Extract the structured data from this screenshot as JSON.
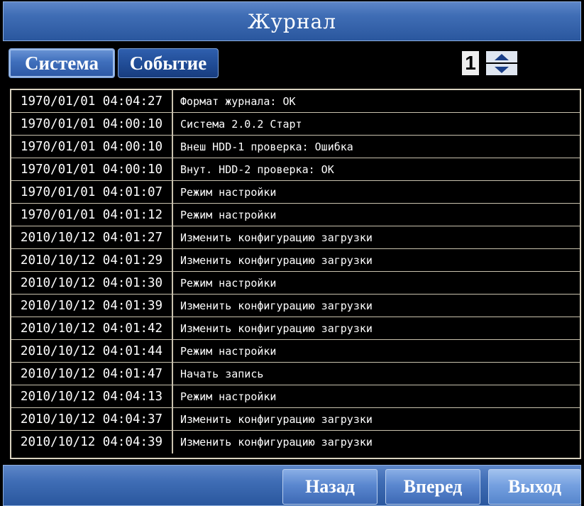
{
  "header": {
    "title": "Журнал"
  },
  "tabs": [
    {
      "label": "Система",
      "active": true
    },
    {
      "label": "Событие",
      "active": false
    }
  ],
  "pager": {
    "page": "1"
  },
  "log": {
    "rows": [
      {
        "time": "1970/01/01 04:04:27",
        "message": "Формат журнала: OK"
      },
      {
        "time": "1970/01/01 04:00:10",
        "message": "Система 2.0.2 Старт"
      },
      {
        "time": "1970/01/01 04:00:10",
        "message": "Внеш HDD-1 проверка: Ошибка"
      },
      {
        "time": "1970/01/01 04:00:10",
        "message": "Внут.  HDD-2 проверка: OK"
      },
      {
        "time": "1970/01/01 04:01:07",
        "message": "Режим настройки"
      },
      {
        "time": "1970/01/01 04:01:12",
        "message": "Режим настройки"
      },
      {
        "time": "2010/10/12 04:01:27",
        "message": "Изменить конфигурацию загрузки"
      },
      {
        "time": "2010/10/12 04:01:29",
        "message": "Изменить конфигурацию загрузки"
      },
      {
        "time": "2010/10/12 04:01:30",
        "message": "Режим настройки"
      },
      {
        "time": "2010/10/12 04:01:39",
        "message": "Изменить конфигурацию загрузки"
      },
      {
        "time": "2010/10/12 04:01:42",
        "message": "Изменить конфигурацию загрузки"
      },
      {
        "time": "2010/10/12 04:01:44",
        "message": "Режим настройки"
      },
      {
        "time": "2010/10/12 04:01:47",
        "message": "Начать запись"
      },
      {
        "time": "2010/10/12 04:04:13",
        "message": "Режим настройки"
      },
      {
        "time": "2010/10/12 04:04:37",
        "message": "Изменить конфигурацию загрузки"
      },
      {
        "time": "2010/10/12 04:04:39",
        "message": "Изменить конфигурацию загрузки"
      }
    ]
  },
  "footer": {
    "back_label": "Назад",
    "next_label": "Вперед",
    "exit_label": "Выход"
  },
  "icons": {
    "page_up": "chevron-up-icon",
    "page_down": "chevron-down-icon"
  },
  "colors": {
    "accent_blue": "#3f6db5",
    "table_border": "#d9d2bf",
    "background": "#000000",
    "text": "#ffffff"
  }
}
